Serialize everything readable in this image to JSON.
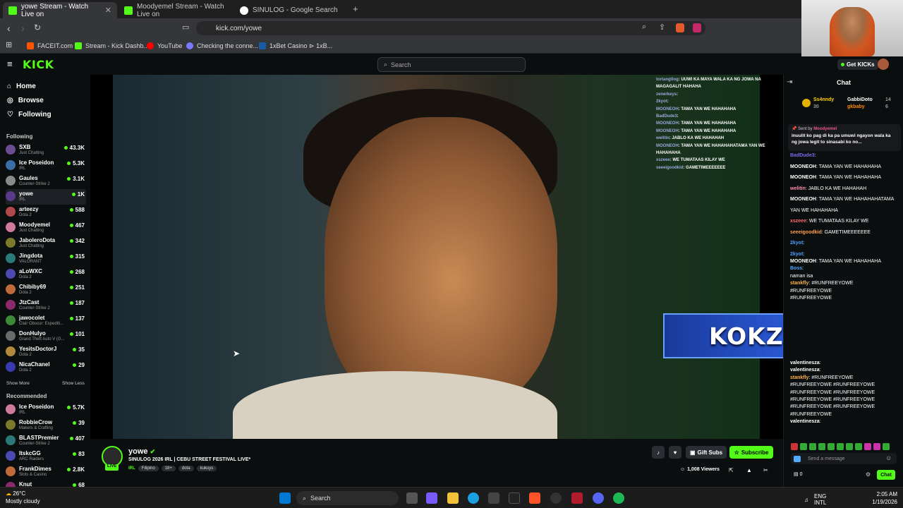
{
  "browser": {
    "tabs": [
      {
        "title": "yowe Stream - Watch Live on",
        "active": true
      },
      {
        "title": "Moodyemel Stream - Watch Live on",
        "active": false
      },
      {
        "title": "SINULOG - Google Search",
        "active": false
      }
    ],
    "url": "kick.com/yowe",
    "bookmarks": [
      "FACEIT.com",
      "Stream - Kick Dashb...",
      "YouTube",
      "Checking the conne...",
      "1xBet Casino ⊳ 1xB..."
    ]
  },
  "header": {
    "logo": "KICK",
    "search_placeholder": "Search",
    "get_kicks": "Get KICKs"
  },
  "sidebar": {
    "nav": [
      {
        "label": "Home",
        "icon": "home-icon"
      },
      {
        "label": "Browse",
        "icon": "browse-icon"
      },
      {
        "label": "Following",
        "icon": "heart-icon"
      }
    ],
    "following_title": "Following",
    "following": [
      {
        "name": "SXB",
        "category": "Just Chatting",
        "viewers": "43.3K"
      },
      {
        "name": "Ice Poseidon",
        "category": "IRL",
        "viewers": "5.3K"
      },
      {
        "name": "Gaules",
        "category": "Counter-Strike 2",
        "viewers": "3.1K"
      },
      {
        "name": "yowe",
        "category": "IRL",
        "viewers": "1K"
      },
      {
        "name": "arteezy",
        "category": "Dota 2",
        "viewers": "588"
      },
      {
        "name": "Moodyemel",
        "category": "Just Chatting",
        "viewers": "467"
      },
      {
        "name": "JaboleroDota",
        "category": "Just Chatting",
        "viewers": "342"
      },
      {
        "name": "Jingdota",
        "category": "VALORANT",
        "viewers": "315"
      },
      {
        "name": "aLoWXC",
        "category": "Dota 2",
        "viewers": "268"
      },
      {
        "name": "Chibiby69",
        "category": "Dota 2",
        "viewers": "251"
      },
      {
        "name": "JtzCast",
        "category": "Counter-Strike 2",
        "viewers": "187"
      },
      {
        "name": "jawocolet",
        "category": "Clair Obscur: Expediti...",
        "viewers": "137"
      },
      {
        "name": "DonHulyo",
        "category": "Grand Theft Auto V (G...",
        "viewers": "101"
      },
      {
        "name": "YesitsDoctorJ",
        "category": "Dota 2",
        "viewers": "35"
      },
      {
        "name": "NicaChanel",
        "category": "Dota 2",
        "viewers": "29"
      }
    ],
    "show_more": "Show More",
    "show_less": "Show Less",
    "recommended_title": "Recommended",
    "recommended": [
      {
        "name": "Ice Poseidon",
        "category": "IRL",
        "viewers": "5.7K"
      },
      {
        "name": "RobbieCrow",
        "category": "Makers & Crafting",
        "viewers": "39"
      },
      {
        "name": "BLASTPremier",
        "category": "Counter-Strike 2",
        "viewers": "407"
      },
      {
        "name": "ItskcGG",
        "category": "ARC Raiders",
        "viewers": "83"
      },
      {
        "name": "FrankDimes",
        "category": "Slots & Casino",
        "viewers": "2.8K"
      },
      {
        "name": "Knut",
        "category": "",
        "viewers": "68"
      }
    ]
  },
  "video_overlay": {
    "chat_lines": [
      {
        "user": "tortangtlog",
        "text": "UUWI KA MAYA WALA KA NG JOWA NA MAGAGALIT HAHAHA"
      },
      {
        "user": "zenerkeys",
        "text": ""
      },
      {
        "user": "2kyot",
        "text": ""
      },
      {
        "user": "MOONEOH",
        "text": "TAMA YAN WE HAHAHAHA"
      },
      {
        "user": "BadDude3",
        "text": ""
      },
      {
        "user": "MOONEOH",
        "text": "TAMA YAN WE HAHAHAHA"
      },
      {
        "user": "MOONEOH",
        "text": "TAMA YAN WE HAHAHAHA"
      },
      {
        "user": "welitin",
        "text": "JABLO KA WE HAHAHAH"
      },
      {
        "user": "MOONEOH",
        "text": "TAMA YAN WE HAHAHAHATAMA YAN WE HAHAHAHA"
      },
      {
        "user": "xszeee",
        "text": "WE TUMATAAS KILAY WE"
      },
      {
        "user": "seeeigoodkid",
        "text": "GAMETIMEEEEEEE"
      }
    ],
    "banner": "KOKZBONUS"
  },
  "stream": {
    "channel": "yowe",
    "live_badge": "LIVE",
    "title": "SINULOG 2026 IRL | CEBU STREET FESTIVAL LIVE*",
    "category": "IRL",
    "tags": [
      "Filipino",
      "18+",
      "dota",
      "kukuys"
    ],
    "gift_subs": "Gift Subs",
    "subscribe": "Subscribe",
    "viewers": "1,008 Viewers"
  },
  "chat": {
    "title": "Chat",
    "leaderboard": [
      {
        "name": "Ss4nndy",
        "count": "30"
      },
      {
        "name": "GabbiDoto",
        "count": "14"
      },
      {
        "name": "gkbaby",
        "count": "6"
      }
    ],
    "pinned_by_label": "Sent by",
    "pinned_by_user": "Moodyemel",
    "pinned_text": "inuulit ko pag di ka pa umuwi ngayon wala ka ng jowa legit to sinasabi ko no...",
    "messages": [
      {
        "user": "BadDude3",
        "text": ""
      },
      {
        "user": "MOONEOH",
        "text": "TAMA YAN WE HAHAHAHA"
      },
      {
        "user": "MOONEOH",
        "text": "TAMA YAN WE HAHAHAHA"
      },
      {
        "user": "welitin",
        "text": "JABLO KA WE HAHAHAH"
      },
      {
        "user": "MOONEOH",
        "text": "TAMA YAN WE HAHAHAHATAMA"
      },
      {
        "user": "",
        "text": "YAN WE HAHAHAHA"
      },
      {
        "user": "xszeee",
        "text": "WE TUMATAAS KILAY WE"
      },
      {
        "user": "seeeigoodkid",
        "text": "GAMETIMEEEEEEE"
      },
      {
        "user": "2kyot",
        "text": ""
      },
      {
        "user": "2kyot",
        "text": ""
      },
      {
        "user": "MOONEOH",
        "text": "TAMA YAN WE HAHAHAHA"
      },
      {
        "user": "Boss",
        "text": ""
      },
      {
        "user": "",
        "text": "naman isa"
      },
      {
        "user": "stankfly",
        "text": "#RUNFREEYOWE"
      },
      {
        "user": "",
        "text": "#RUNFREEYOWE"
      },
      {
        "user": "",
        "text": "#RUNFREEYOWE"
      },
      {
        "user": "valentinesza",
        "text": ""
      },
      {
        "user": "valentinesza",
        "text": ""
      },
      {
        "user": "stankfly",
        "text": "#RUNFREEYOWE"
      },
      {
        "user": "",
        "text": "#RUNFREEYOWE #RUNFREEYOWE"
      },
      {
        "user": "",
        "text": "#RUNFREEYOWE #RUNFREEYOWE"
      },
      {
        "user": "",
        "text": "#RUNFREEYOWE #RUNFREEYOWE"
      },
      {
        "user": "",
        "text": "#RUNFREEYOWE #RUNFREEYOWE"
      },
      {
        "user": "",
        "text": "#RUNFREEYOWE"
      },
      {
        "user": "valentinesza",
        "text": ""
      }
    ],
    "input_placeholder": "Send a message",
    "points": "0",
    "send_label": "Chat"
  },
  "taskbar": {
    "weather_temp": "26°C",
    "weather_desc": "Mostly cloudy",
    "search": "Search",
    "lang": "ENG",
    "lang2": "INTL",
    "time": "2:05 AM",
    "date": "1/19/2026"
  },
  "colors": {
    "accent": "#53fc18",
    "background": "#0b0e0f"
  }
}
